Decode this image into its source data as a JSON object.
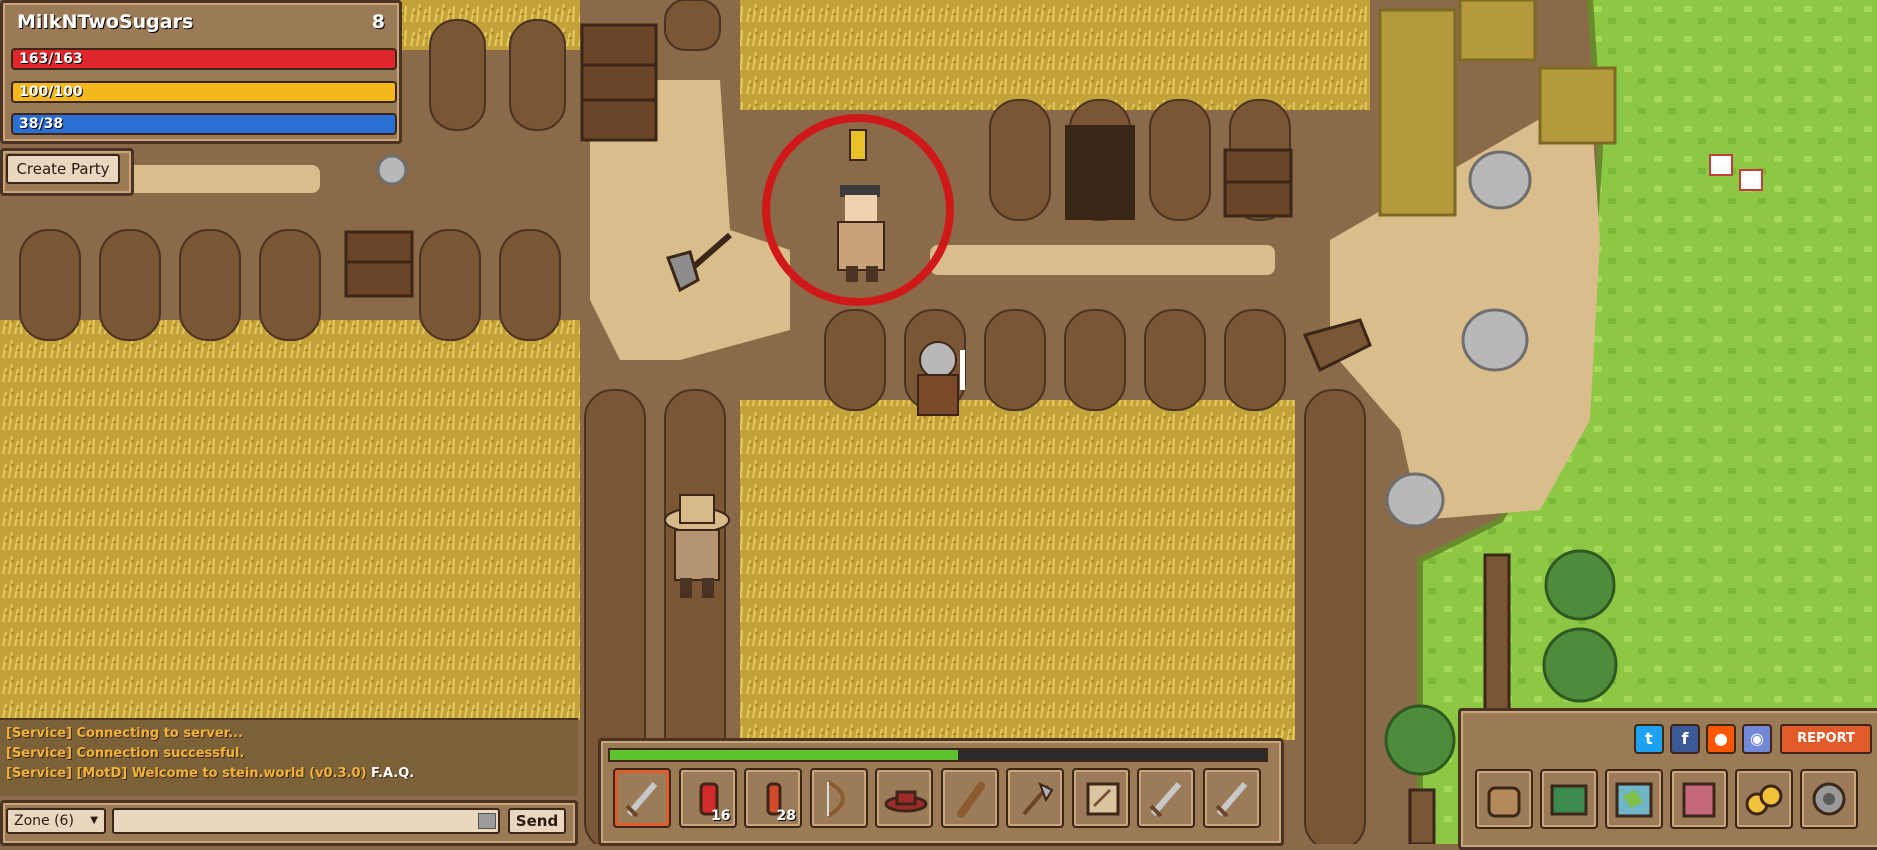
{
  "player": {
    "name": "MilkNTwoSugars",
    "level": "8",
    "hp": "163/163",
    "stamina": "100/100",
    "mana": "38/38",
    "hp_fraction": 1.0,
    "stamina_fraction": 1.0,
    "mana_fraction": 1.0
  },
  "party": {
    "create_label": "Create Party"
  },
  "chat": {
    "messages": [
      "[Service] Connecting to server...",
      "[Service] Connection successful.",
      "[Service] [MotD] Welcome to stein.world (v0.3.0)"
    ],
    "faq_link": "F.A.Q.",
    "channel": "Zone (6)",
    "input_value": "",
    "send_label": "Send"
  },
  "hotbar": {
    "xp_fraction": 0.53,
    "slots": [
      {
        "item": "sword-icon",
        "count": ""
      },
      {
        "item": "health-potion-icon",
        "count": "16"
      },
      {
        "item": "mana-potion-icon",
        "count": "28"
      },
      {
        "item": "bow-icon",
        "count": ""
      },
      {
        "item": "hat-icon",
        "count": ""
      },
      {
        "item": "club-icon",
        "count": ""
      },
      {
        "item": "axe-icon",
        "count": ""
      },
      {
        "item": "scroll-icon",
        "count": ""
      },
      {
        "item": "sword-icon",
        "count": ""
      },
      {
        "item": "sword-icon",
        "count": ""
      }
    ]
  },
  "menu": {
    "report_label": "REPORT",
    "social": [
      "twitter-icon",
      "facebook-icon",
      "reddit-icon",
      "discord-icon"
    ],
    "buttons": [
      "inventory-bag-icon",
      "quest-book-icon",
      "world-map-icon",
      "character-icon",
      "gold-coins-icon",
      "settings-gear-icon"
    ]
  },
  "colors": {
    "hp": "#e0262a",
    "stamina": "#f2b81c",
    "mana": "#2b6fd6",
    "xp": "#5ec22d",
    "wheat": "#c9a93c",
    "dirt": "#8a6a49",
    "grass": "#8cc843",
    "target_ring": "#d01818"
  }
}
